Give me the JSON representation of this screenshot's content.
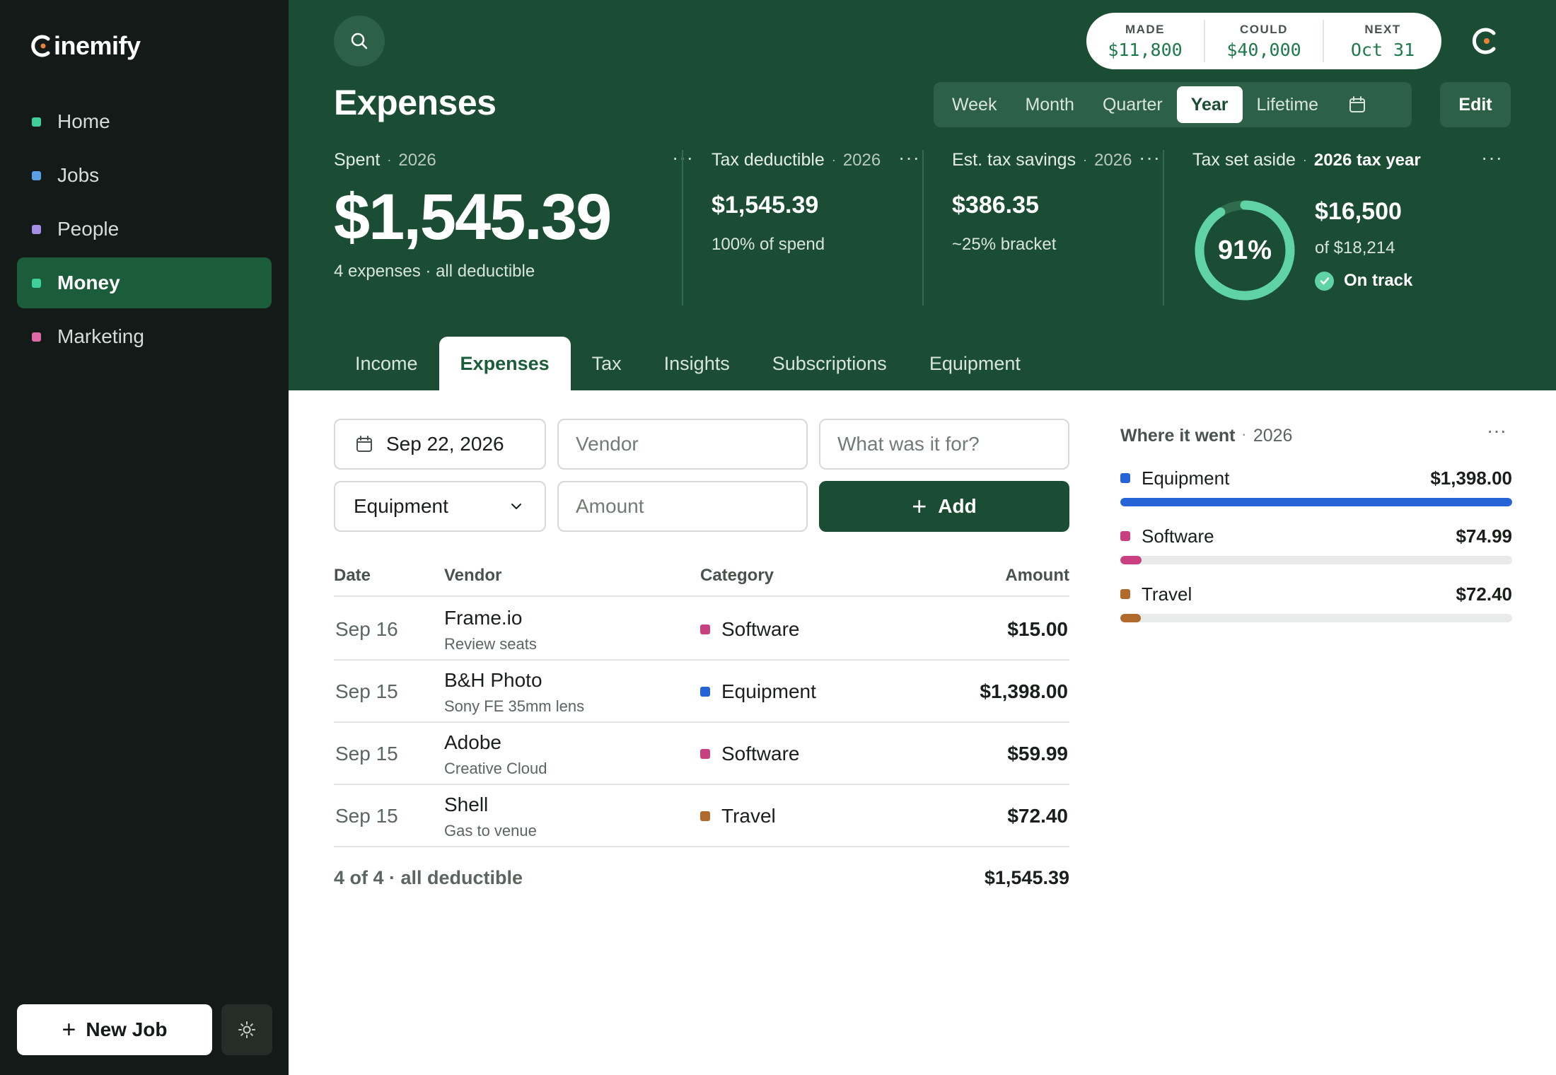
{
  "app": {
    "logo_text": "inemify"
  },
  "sidebar": {
    "items": [
      {
        "label": "Home",
        "color": "#3ecf9a",
        "active": false
      },
      {
        "label": "Jobs",
        "color": "#5b9ee6",
        "active": false
      },
      {
        "label": "People",
        "color": "#a58fe6",
        "active": false
      },
      {
        "label": "Money",
        "color": "#3ecf9a",
        "active": true
      },
      {
        "label": "Marketing",
        "color": "#e06aa8",
        "active": false
      }
    ],
    "new_job_label": "New Job"
  },
  "topbar": {
    "stats": [
      {
        "label": "MADE",
        "value": "$11,800"
      },
      {
        "label": "COULD",
        "value": "$40,000"
      },
      {
        "label": "NEXT",
        "value": "Oct 31"
      }
    ]
  },
  "page": {
    "title": "Expenses"
  },
  "periods": {
    "options": [
      "Week",
      "Month",
      "Quarter",
      "Year",
      "Lifetime"
    ],
    "selected": "Year"
  },
  "edit_label": "Edit",
  "cards": {
    "spent": {
      "label": "Spent",
      "year": "2026",
      "amount": "$1,545.39",
      "sub": "4 expenses · all deductible"
    },
    "deductible": {
      "label": "Tax deductible",
      "year": "2026",
      "amount": "$1,545.39",
      "sub": "100% of spend"
    },
    "savings": {
      "label": "Est. tax savings",
      "year": "2026",
      "amount": "$386.35",
      "sub": "~25% bracket"
    },
    "setaside": {
      "label": "Tax set aside",
      "year": "2026 tax year",
      "percent_label": "91%",
      "percent": 91,
      "amount": "$16,500",
      "of": "of $18,214",
      "status": "On track"
    }
  },
  "tabs": [
    "Income",
    "Expenses",
    "Tax",
    "Insights",
    "Subscriptions",
    "Equipment"
  ],
  "active_tab": "Expenses",
  "form": {
    "date_value": "Sep 22, 2026",
    "vendor_placeholder": "Vendor",
    "purpose_placeholder": "What was it for?",
    "category_value": "Equipment",
    "amount_placeholder": "Amount",
    "add_label": "Add"
  },
  "table": {
    "headers": {
      "date": "Date",
      "vendor": "Vendor",
      "category": "Category",
      "amount": "Amount"
    },
    "rows": [
      {
        "date": "Sep 16",
        "vendor": "Frame.io",
        "note": "Review seats",
        "category": "Software",
        "cat_color": "#c8407f",
        "amount": "$15.00"
      },
      {
        "date": "Sep 15",
        "vendor": "B&H Photo",
        "note": "Sony FE 35mm lens",
        "category": "Equipment",
        "cat_color": "#2563d6",
        "amount": "$1,398.00"
      },
      {
        "date": "Sep 15",
        "vendor": "Adobe",
        "note": "Creative Cloud",
        "category": "Software",
        "cat_color": "#c8407f",
        "amount": "$59.99"
      },
      {
        "date": "Sep 15",
        "vendor": "Shell",
        "note": "Gas to venue",
        "category": "Travel",
        "cat_color": "#b06a2c",
        "amount": "$72.40"
      }
    ],
    "footer_label": "4 of 4 · all deductible",
    "footer_total": "$1,545.39"
  },
  "where_it_went": {
    "title": "Where it went",
    "year": "2026",
    "items": [
      {
        "label": "Equipment",
        "amount": "$1,398.00",
        "value": 1398.0,
        "color": "#2563d6"
      },
      {
        "label": "Software",
        "amount": "$74.99",
        "value": 74.99,
        "color": "#c8407f"
      },
      {
        "label": "Travel",
        "amount": "$72.40",
        "value": 72.4,
        "color": "#b06a2c"
      }
    ]
  }
}
